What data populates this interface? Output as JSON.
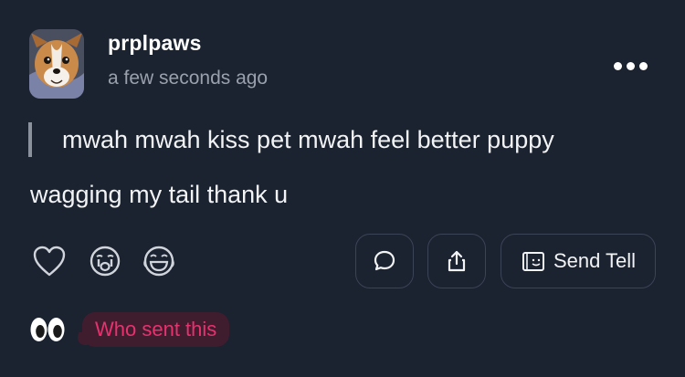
{
  "post": {
    "username": "prplpaws",
    "timestamp": "a few seconds ago",
    "quote": "mwah mwah kiss pet mwah feel better puppy",
    "reply": "wagging my tail thank u"
  },
  "avatar": {
    "icon": "corgi-dog-photo"
  },
  "menu": {
    "icon": "more-dots-icon"
  },
  "reactions": [
    {
      "icon": "heart-icon"
    },
    {
      "icon": "crying-face-icon"
    },
    {
      "icon": "laughing-face-icon"
    }
  ],
  "actions": {
    "comment_icon": "comment-icon",
    "share_icon": "share-icon",
    "send_tell_label": "Send Tell",
    "send_tell_icon": "envelope-icon"
  },
  "footer": {
    "emoji": "👀",
    "badge_label": "Who sent this"
  },
  "colors": {
    "background": "#1b2230",
    "text": "#f2f3f5",
    "muted": "#9aa1ad",
    "border": "#3b4456",
    "badge_bg": "#3f1d2f",
    "badge_text": "#e8316d"
  }
}
